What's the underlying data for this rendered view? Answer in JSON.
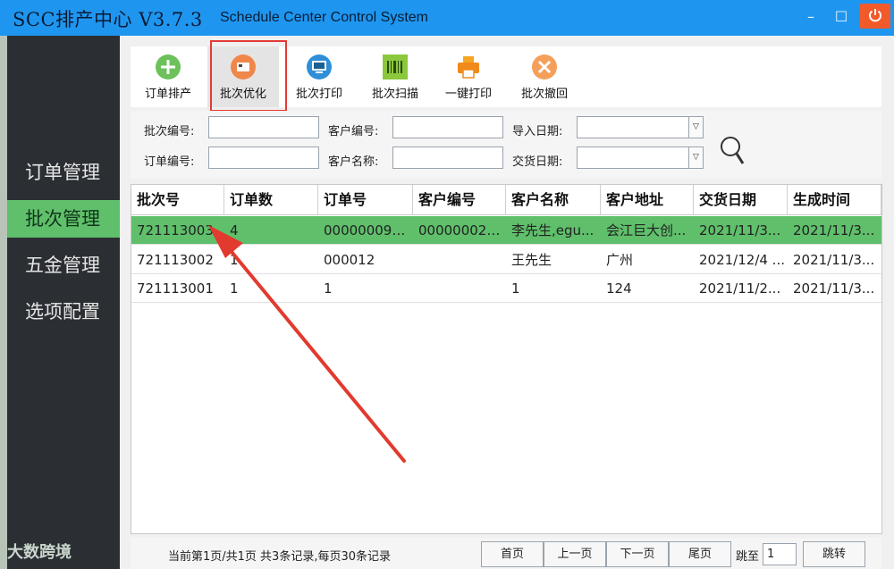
{
  "window": {
    "title": "SCC排产中心 V3.7.3",
    "subtitle": "Schedule Center Control System",
    "minimize_glyph": "–",
    "maximize_glyph": "☐"
  },
  "colors": {
    "titlebar": "#1e96f0",
    "sidebar": "#2b2f33",
    "active": "#5fbf6b",
    "close": "#f25a2a",
    "highlight": "#e53935"
  },
  "sidebar": {
    "items": [
      {
        "label": "订单管理",
        "active": false
      },
      {
        "label": "批次管理",
        "active": true
      },
      {
        "label": "五金管理",
        "active": false
      },
      {
        "label": "选项配置",
        "active": false
      }
    ]
  },
  "watermark": "大数跨境",
  "toolbar": {
    "items": [
      {
        "label": "订单排产",
        "icon": "plus-icon"
      },
      {
        "label": "批次优化",
        "icon": "optimize-icon"
      },
      {
        "label": "批次打印",
        "icon": "monitor-icon"
      },
      {
        "label": "批次扫描",
        "icon": "barcode-icon"
      },
      {
        "label": "一键打印",
        "icon": "printer-icon"
      },
      {
        "label": "批次撤回",
        "icon": "cancel-icon"
      }
    ]
  },
  "search": {
    "batch_no_label": "批次编号:",
    "customer_no_label": "客户编号:",
    "import_date_label": "导入日期:",
    "order_no_label": "订单编号:",
    "customer_name_label": "客户名称:",
    "delivery_date_label": "交货日期:",
    "batch_no": "",
    "customer_no": "",
    "import_date": "",
    "order_no": "",
    "customer_name": "",
    "delivery_date": ""
  },
  "table": {
    "columns": [
      "批次号",
      "订单数",
      "订单号",
      "客户编号",
      "客户名称",
      "客户地址",
      "交货日期",
      "生成时间"
    ],
    "rows": [
      {
        "selected": true,
        "cells": [
          "721113003",
          "4",
          "000000092...",
          "000000024...",
          "李先生,egu...",
          "会江巨大创...",
          "2021/11/3...",
          "2021/11/3..."
        ]
      },
      {
        "selected": false,
        "cells": [
          "721113002",
          "1",
          "000012",
          "",
          "王先生",
          "广州",
          "2021/12/4 ...",
          "2021/11/3..."
        ]
      },
      {
        "selected": false,
        "cells": [
          "721113001",
          "1",
          "1",
          "",
          "1",
          "124",
          "2021/11/2...",
          "2021/11/3..."
        ]
      }
    ]
  },
  "footer": {
    "page_info": "当前第1页/共1页  共3条记录,每页30条记录",
    "first": "首页",
    "prev": "上一页",
    "next": "下一页",
    "last": "尾页",
    "jump_label": "跳至",
    "jump_value": "1",
    "jump_button": "跳转"
  }
}
